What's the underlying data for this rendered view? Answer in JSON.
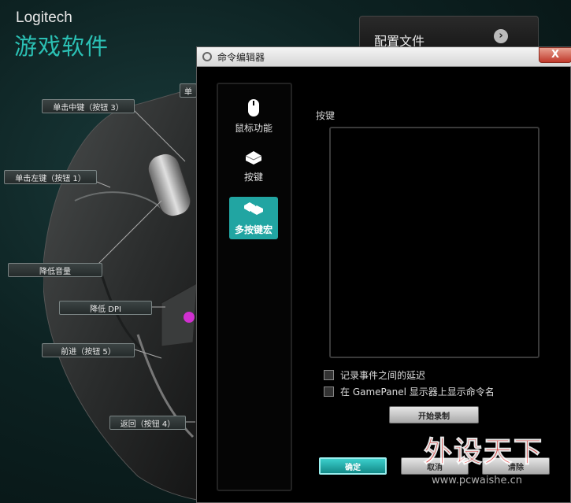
{
  "brand": {
    "title": "Logitech",
    "subtitle": "游戏软件"
  },
  "callouts": {
    "middle": "单击中键（按钮 3）",
    "left": "单击左键（按钮 1）",
    "vol_down": "降低音量",
    "dpi_down": "降低 DPI",
    "forward": "前进（按钮 5）",
    "back": "返回（按钮 4）",
    "partial_top": "单"
  },
  "profile_panel": {
    "label": "配置文件",
    "arrow_icon": "chevron-right-icon"
  },
  "dialog": {
    "title": "命令编辑器",
    "close": "X",
    "sidebar": [
      {
        "label": "鼠标功能",
        "icon": "mouse-icon",
        "active": false
      },
      {
        "label": "按键",
        "icon": "key-icon",
        "active": false
      },
      {
        "label": "多按键宏",
        "icon": "multikey-icon",
        "active": true
      }
    ],
    "keys_label": "按键",
    "checkbox_delay": "记录事件之间的延迟",
    "checkbox_gamepanel": "在 GamePanel 显示器上显示命令名",
    "record_button": "开始录制",
    "ok_button": "确定",
    "cancel_button": "取消",
    "clear_button": "清除"
  },
  "watermark": {
    "text": "外设天下",
    "url": "www.pcwaishe.cn"
  },
  "colors": {
    "accent": "#21a5a2",
    "brand_teal": "#2bc0b4",
    "watermark_red": "#e83030"
  }
}
